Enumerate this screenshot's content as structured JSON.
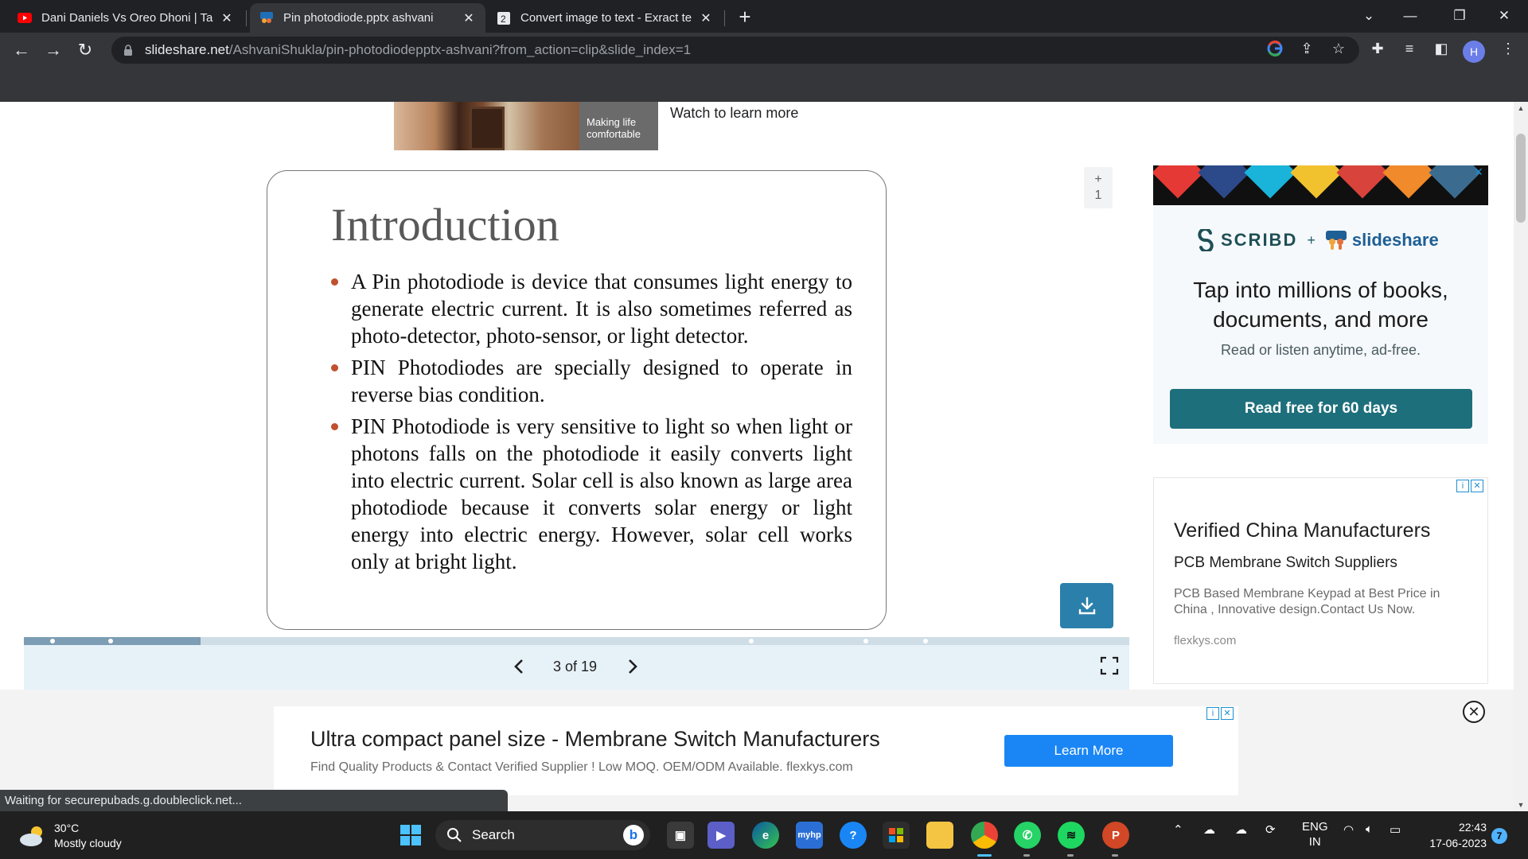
{
  "browser": {
    "tabs": [
      {
        "title": "Dani Daniels Vs Oreo Dhoni | Tam",
        "favicon": "youtube-icon",
        "active": false
      },
      {
        "title": "Pin photodiode.pptx ashvani",
        "favicon": "slideshare-icon",
        "active": true
      },
      {
        "title": "Convert image to text - Exract te",
        "favicon": "ocr-icon",
        "active": false
      }
    ],
    "url_host": "slideshare.net",
    "url_path": "/AshvaniShukla/pin-photodiodepptx-ashvani?from_action=clip&slide_index=1",
    "profile_initial": "H"
  },
  "top_ad": {
    "label": "Making life comfortable",
    "watch_text": "Watch to learn more"
  },
  "slide": {
    "title": "Introduction",
    "bullets": [
      "A Pin photodiode is device that consumes light energy to generate electric current. It is also sometimes referred as photo-detector, photo-sensor, or light detector.",
      "PIN Photodiodes are specially designed to operate in reverse bias condition.",
      "PIN Photodiode is very sensitive to light so when light or photons falls on the photodiode it easily converts light into electric current. Solar cell is also known as large area photodiode because it converts solar energy or light energy into electric energy. However, solar cell works only at bright light."
    ],
    "bullet_color": "#c0502f"
  },
  "viewer": {
    "clip_plus": "+",
    "clip_count": "1",
    "page_counter": "3 of 19",
    "progress_fraction": 0.16
  },
  "scribd_ad": {
    "brand_left": "SCRIBD",
    "plus": "+",
    "brand_right": "slideshare",
    "headline": "Tap into millions of books, documents, and more",
    "subtext": "Read or listen anytime, ad-free.",
    "button": "Read free for 60 days",
    "accent": "#1e6f7c"
  },
  "flex_ad": {
    "title": "Verified China Manufacturers",
    "subtitle": "PCB Membrane Switch Suppliers",
    "description": "PCB Based Membrane Keypad at Best Price in China , Innovative design.Contact Us Now.",
    "domain": "flexkys.com"
  },
  "bottom_ad": {
    "title": "Ultra compact panel size - Membrane Switch Manufacturers",
    "description": "Find Quality Products & Contact Verified Supplier ! Low MOQ. OEM/ODM Available. flexkys.com",
    "button": "Learn More",
    "button_color": "#1a86f5"
  },
  "status_text": "Waiting for securepubads.g.doubleclick.net...",
  "taskbar": {
    "temperature": "30°C",
    "weather": "Mostly cloudy",
    "search_label": "Search",
    "lang_top": "ENG",
    "lang_bottom": "IN",
    "time": "22:43",
    "date": "17-06-2023",
    "notifications": "7"
  }
}
